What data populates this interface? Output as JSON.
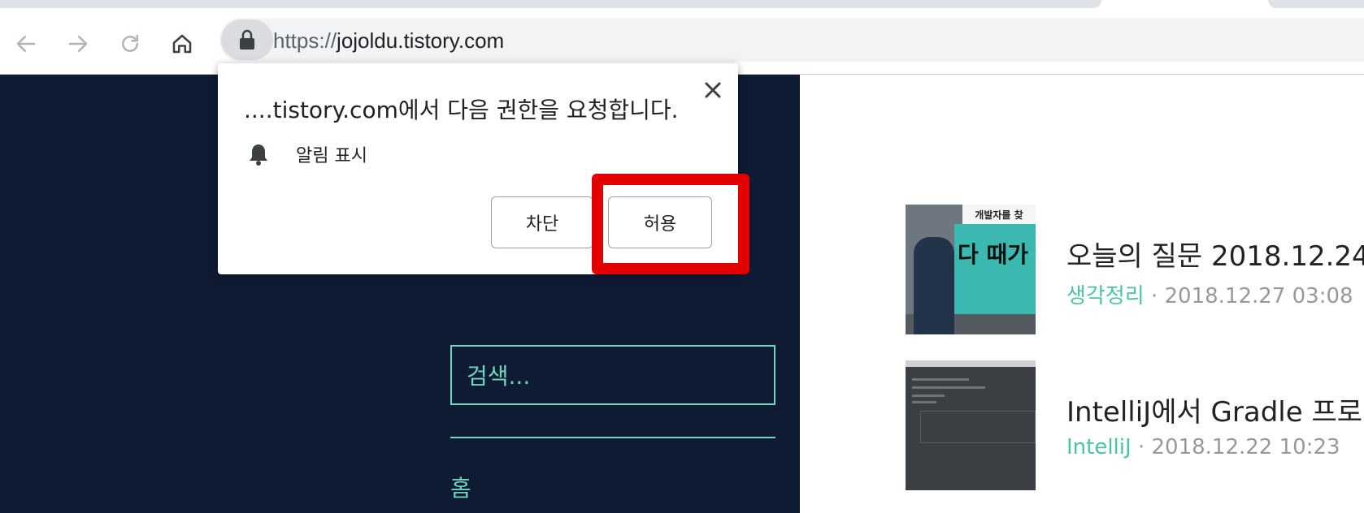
{
  "browser": {
    "url_scheme": "https://",
    "url_host": "jojoldu.tistory.com",
    "back_icon": "arrow-left-icon",
    "forward_icon": "arrow-right-icon",
    "reload_icon": "reload-icon",
    "home_icon": "home-icon",
    "lock_icon": "lock-icon"
  },
  "permission_popup": {
    "title": "....tistory.com에서 다음 권한을 요청합니다.",
    "permission_label": "알림 표시",
    "permission_icon": "bell-icon",
    "block_label": "차단",
    "allow_label": "허용",
    "close_icon": "close-icon"
  },
  "sidebar": {
    "search_placeholder": "검색...",
    "nav_home": "홈"
  },
  "posts": [
    {
      "title": "오늘의 질문 2018.12.24",
      "category": "생각정리",
      "separator": " · ",
      "date": "2018.12.27 03:08",
      "thumb_text": "개발자를 찾",
      "thumb_big_text": "다 때가"
    },
    {
      "title": "IntelliJ에서 Gradle 프로젝",
      "category": "IntelliJ",
      "separator": " · ",
      "date": "2018.12.22 10:23"
    }
  ],
  "colors": {
    "sidebar_bg": "#0f1a33",
    "accent": "#6fd6bf",
    "category_green": "#4cc4a4",
    "highlight_red": "#e30000"
  }
}
